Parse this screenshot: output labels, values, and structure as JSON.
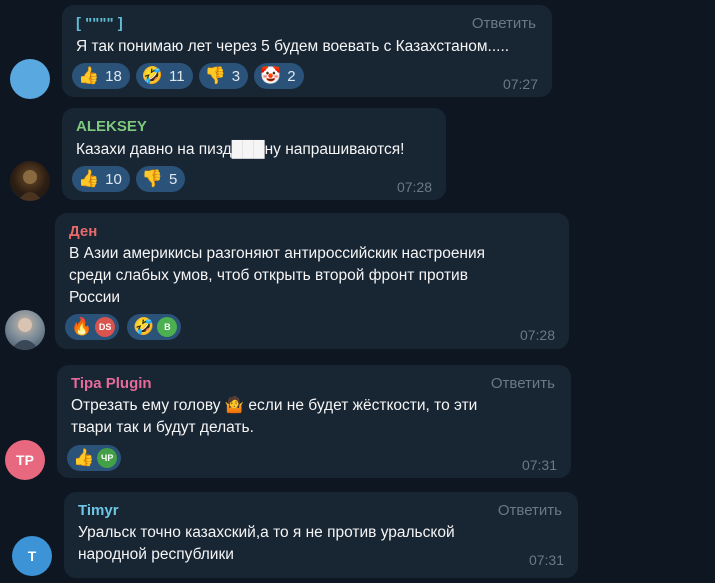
{
  "messages": [
    {
      "author": "[ \"\"\"\" ]",
      "author_color": "#5fbcd3",
      "reply_label": "Ответить",
      "text": "Я так понимаю лет через 5 будем воевать с Казахстаном.....",
      "time": "07:27",
      "avatar_color": "#5aa8e0",
      "reactions": [
        {
          "icon": "thumbs-up",
          "glyph": "👍",
          "count": "18"
        },
        {
          "icon": "rofl",
          "glyph": "🤣",
          "count": "11"
        },
        {
          "icon": "thumbs-down",
          "glyph": "👎",
          "count": "3"
        },
        {
          "icon": "clown",
          "glyph": "🤡",
          "count": "2"
        }
      ]
    },
    {
      "author": "ALEKSEY",
      "author_color": "#7ec97e",
      "text": "Казахи давно на пизд███ну напрашиваются!",
      "time": "07:28",
      "reactions": [
        {
          "icon": "thumbs-up",
          "glyph": "👍",
          "count": "10"
        },
        {
          "icon": "thumbs-down",
          "glyph": "👎",
          "count": "5"
        }
      ]
    },
    {
      "author": "Ден",
      "author_color": "#e86b6b",
      "text": "В Азии америкисы разгоняют антироссийскик настроения\nсреди слабых умов, чтоб открыть второй фронт против\nРоссии",
      "time": "07:28",
      "reactions": [
        {
          "icon": "fire",
          "glyph": "🔥",
          "user": "DS",
          "user_color": "#d9534f"
        },
        {
          "icon": "rofl",
          "glyph": "🤣",
          "user": "B",
          "user_color": "#4caf50"
        }
      ]
    },
    {
      "author": "Tipa Plugin",
      "author_color": "#e66b9a",
      "reply_label": "Ответить",
      "text": "Отрезать ему голову 🤷 если не будет жёсткости, то эти\nтвари так и будут делать.",
      "time": "07:31",
      "avatar_initials": "TP",
      "avatar_color": "#e8697f",
      "reactions": [
        {
          "icon": "thumbs-up",
          "glyph": "👍",
          "user": "ЧР",
          "user_color": "#43a047"
        }
      ]
    },
    {
      "author": "Timyr",
      "author_color": "#6ec6e6",
      "reply_label": "Ответить",
      "text": "Уральск точно казахский,а то я не против уральской\nнародной республики",
      "time": "07:31",
      "avatar_initials": "T",
      "avatar_color": "#3c93d6"
    }
  ]
}
